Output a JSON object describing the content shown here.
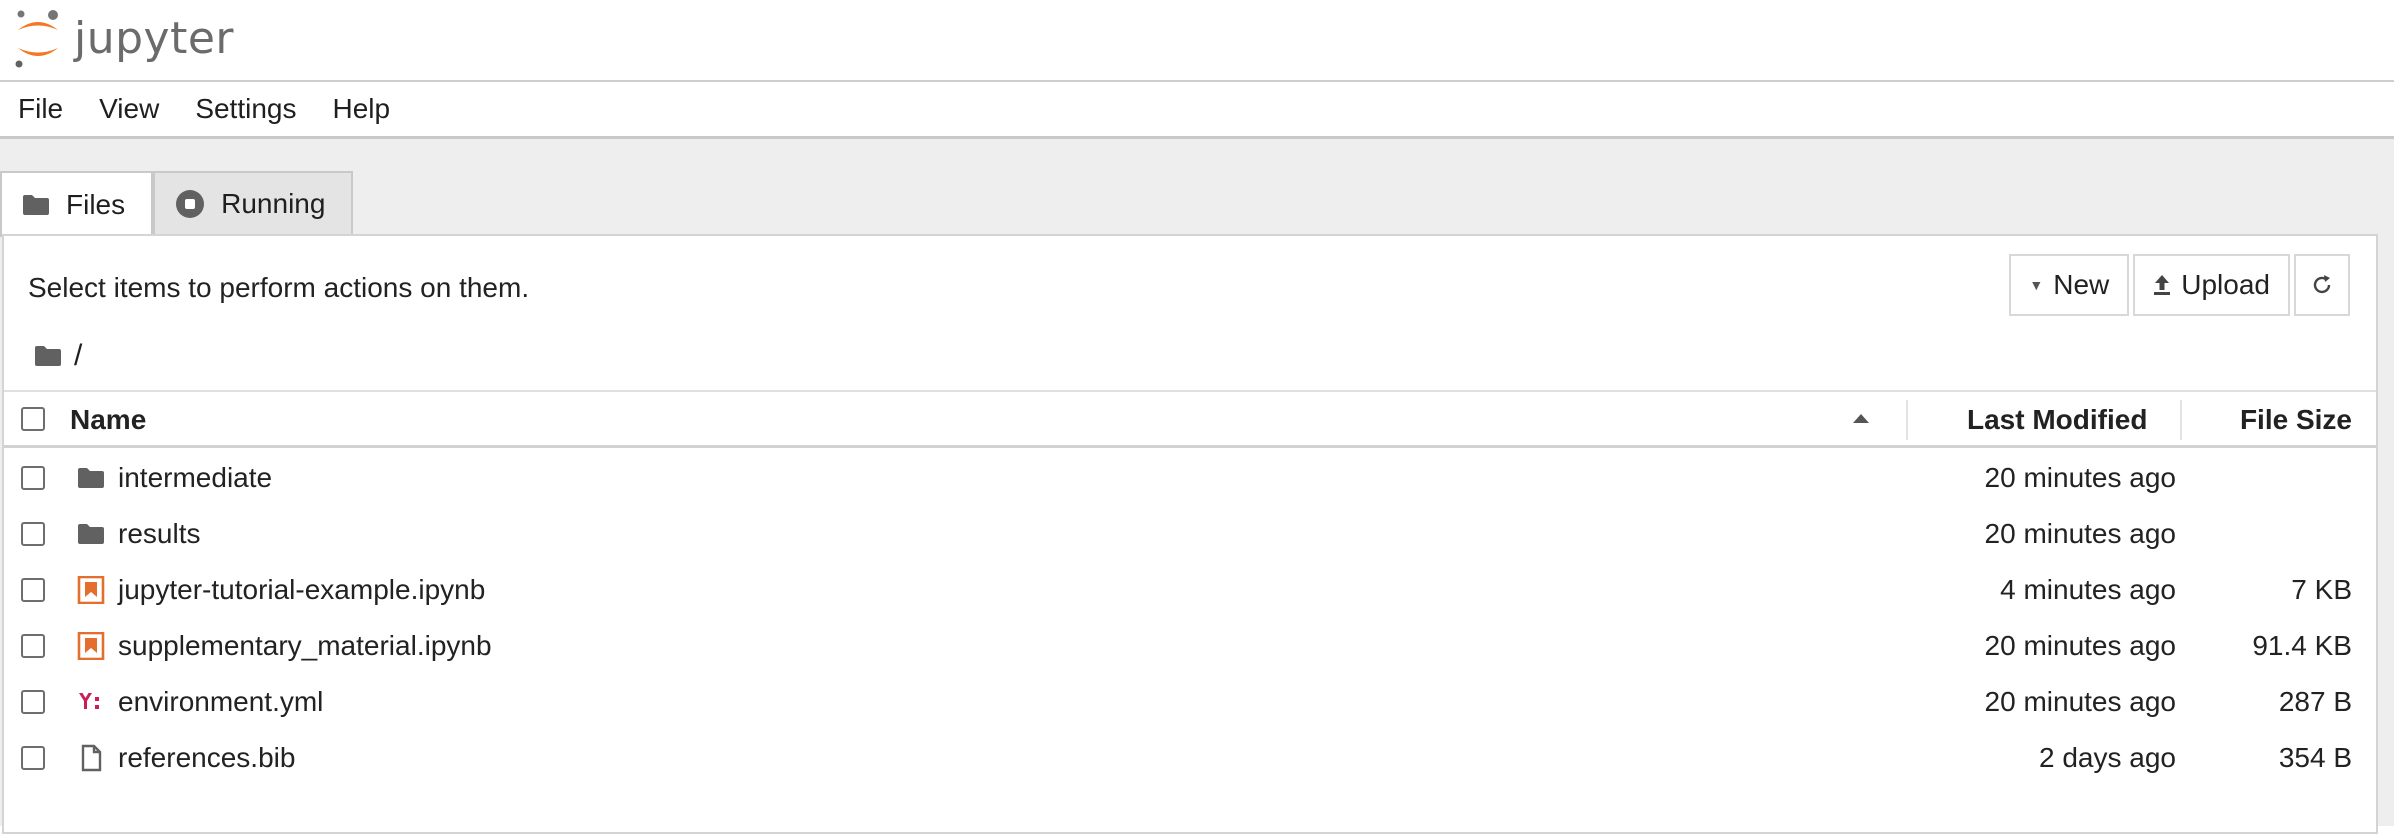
{
  "header": {
    "logo_text": "jupyter",
    "accent_color": "#F37726"
  },
  "menubar": {
    "items": [
      "File",
      "View",
      "Settings",
      "Help"
    ]
  },
  "tabs": [
    {
      "label": "Files",
      "icon": "folder-icon",
      "active": true
    },
    {
      "label": "Running",
      "icon": "stop-circle-icon",
      "active": false
    }
  ],
  "panel": {
    "help_text": "Select items to perform actions on them.",
    "toolbar": {
      "new_label": "New",
      "upload_label": "Upload",
      "refresh_icon": "refresh-icon"
    },
    "breadcrumb": {
      "icon": "folder-icon",
      "path": "/"
    }
  },
  "table": {
    "columns": {
      "name": "Name",
      "modified": "Last Modified",
      "size": "File Size"
    },
    "sort": {
      "column": "name",
      "direction": "ascending"
    },
    "rows": [
      {
        "name": "intermediate",
        "type": "folder",
        "icon": "folder-icon",
        "modified": "20 minutes ago",
        "size": ""
      },
      {
        "name": "results",
        "type": "folder",
        "icon": "folder-icon",
        "modified": "20 minutes ago",
        "size": ""
      },
      {
        "name": "jupyter-tutorial-example.ipynb",
        "type": "notebook",
        "icon": "notebook-icon",
        "modified": "4 minutes ago",
        "size": "7 KB"
      },
      {
        "name": "supplementary_material.ipynb",
        "type": "notebook",
        "icon": "notebook-icon",
        "modified": "20 minutes ago",
        "size": "91.4 KB"
      },
      {
        "name": "environment.yml",
        "type": "yaml",
        "icon": "yaml-icon",
        "modified": "20 minutes ago",
        "size": "287 B"
      },
      {
        "name": "references.bib",
        "type": "file",
        "icon": "file-icon",
        "modified": "2 days ago",
        "size": "354 B"
      }
    ]
  },
  "colors": {
    "notebook_orange": "#E46E2E",
    "yaml_red": "#C71F56",
    "folder_gray": "#616161"
  }
}
